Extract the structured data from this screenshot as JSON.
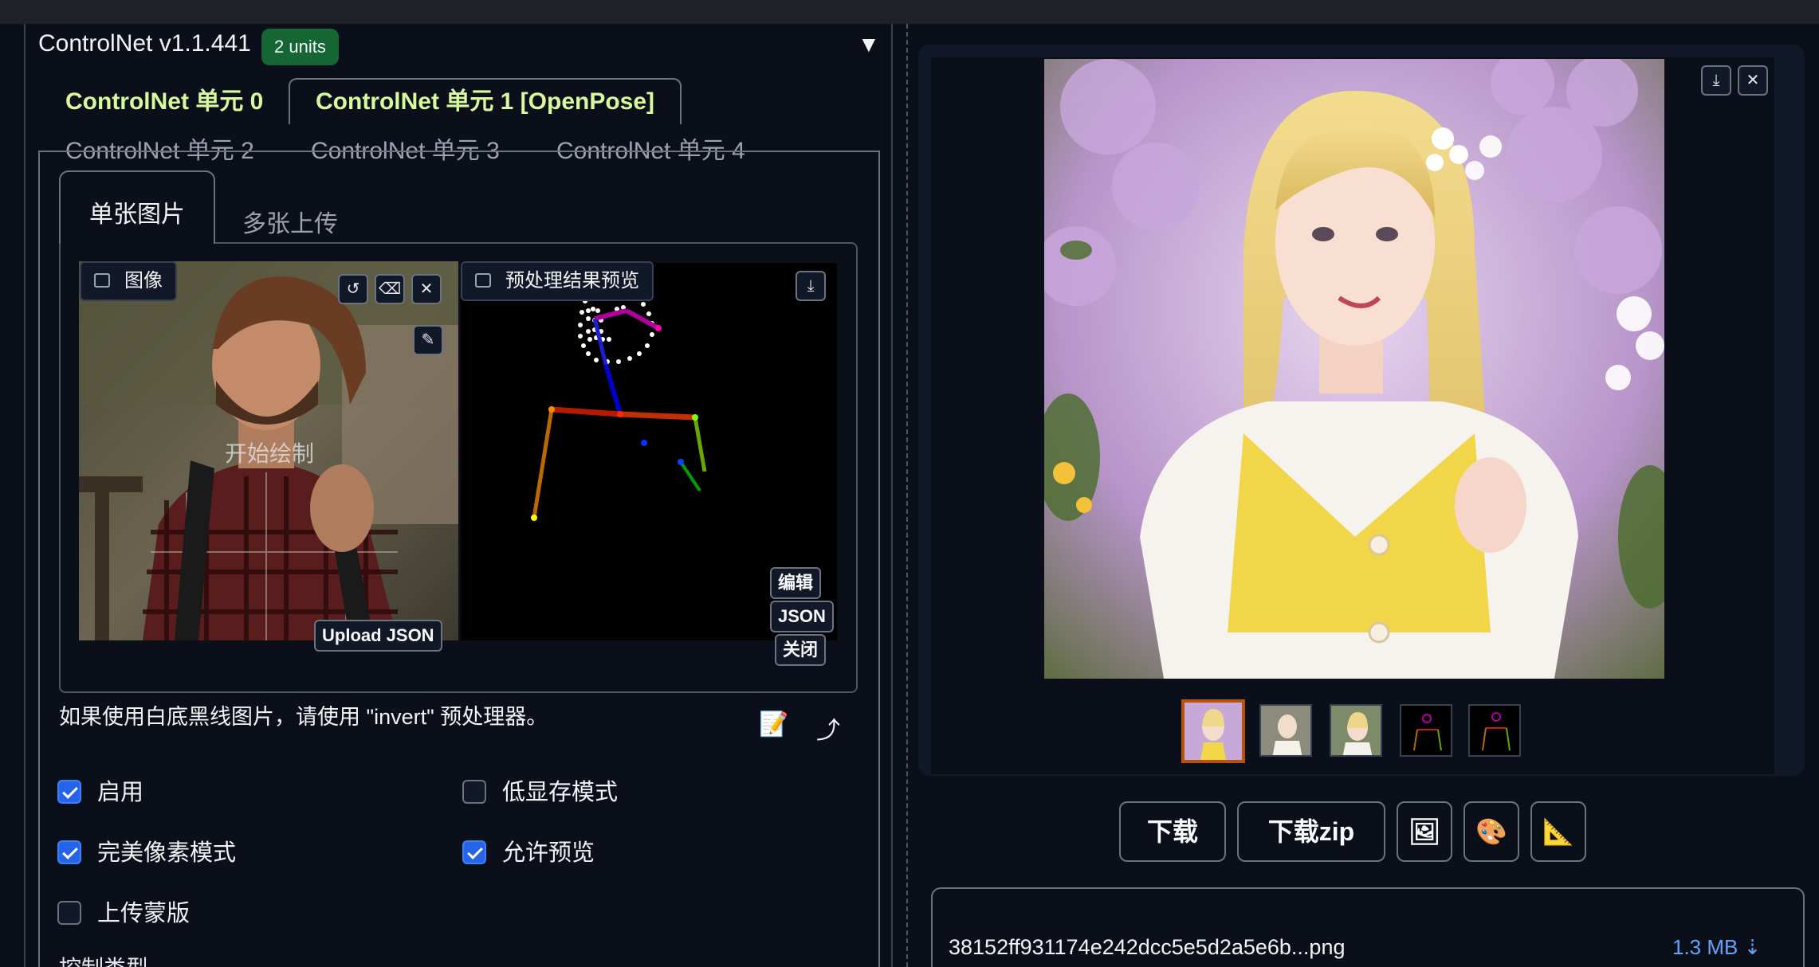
{
  "controlnet": {
    "title": "ControlNet v1.1.441",
    "units_badge": "2 units",
    "collapse_icon": "triangle-down",
    "unit_tabs": [
      "ControlNet 单元 0",
      "ControlNet 单元 1 [OpenPose]",
      "ControlNet 单元 2",
      "ControlNet 单元 3",
      "ControlNet 单元 4"
    ],
    "image_tabs": [
      "单张图片",
      "多张上传"
    ],
    "image_label": "图像",
    "preview_label": "预处理结果预览",
    "start_draw": "开始绘制",
    "upload_json": "Upload JSON",
    "pose_buttons": [
      "编辑",
      "JSON",
      "关闭"
    ],
    "hint": "如果使用白底黑线图片，请使用 \"invert\" 预处理器。",
    "options": [
      {
        "label": "启用",
        "checked": true
      },
      {
        "label": "低显存模式",
        "checked": false
      },
      {
        "label": "完美像素模式",
        "checked": true
      },
      {
        "label": "允许预览",
        "checked": true
      },
      {
        "label": "上传蒙版",
        "checked": false
      }
    ],
    "control_type_label": "控制类型"
  },
  "gallery": {
    "actions": [
      "下载",
      "下载zip"
    ],
    "action_icons": [
      "image-icon",
      "palette-icon",
      "ruler-icon"
    ],
    "file": {
      "name": "38152ff931174e242dcc5e5d2a5e6b...png",
      "size": "1.3 MB ⇣"
    }
  },
  "colors": {
    "accent": "#2563eb",
    "badge": "#166534",
    "active_tab_text": "#d9f99d"
  }
}
